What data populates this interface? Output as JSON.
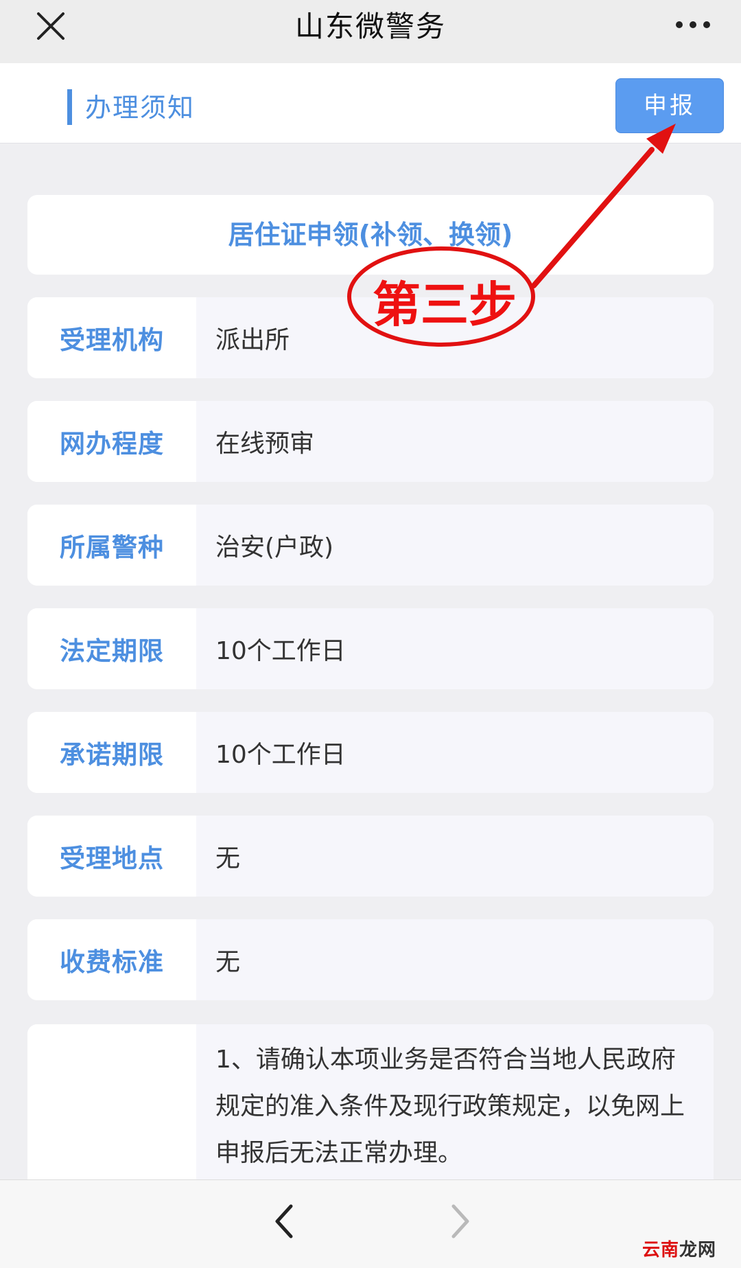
{
  "app": {
    "title": "山东微警务",
    "close_icon": "close-icon",
    "more_icon": "more-dots-icon"
  },
  "header": {
    "section_label": "办理须知",
    "apply_button": "申报"
  },
  "service_title": "居住证申领(补领、换领)",
  "details": [
    {
      "label": "受理机构",
      "value": "派出所"
    },
    {
      "label": "网办程度",
      "value": "在线预审"
    },
    {
      "label": "所属警种",
      "value": "治安(户政)"
    },
    {
      "label": "法定期限",
      "value": "10个工作日"
    },
    {
      "label": "承诺期限",
      "value": "10个工作日"
    },
    {
      "label": "受理地点",
      "value": "无"
    },
    {
      "label": "收费标准",
      "value": "无"
    }
  ],
  "note": "1、请确认本项业务是否符合当地人民政府规定的准入条件及现行政策规定，以免网上申报后无法正常办理。",
  "annotation": {
    "step_text": "第三步",
    "color": "#e11111"
  },
  "footer": {
    "back_icon": "chevron-left-icon",
    "forward_icon": "chevron-right-icon"
  },
  "watermark": {
    "part1": "云南",
    "part2": "龙网"
  }
}
